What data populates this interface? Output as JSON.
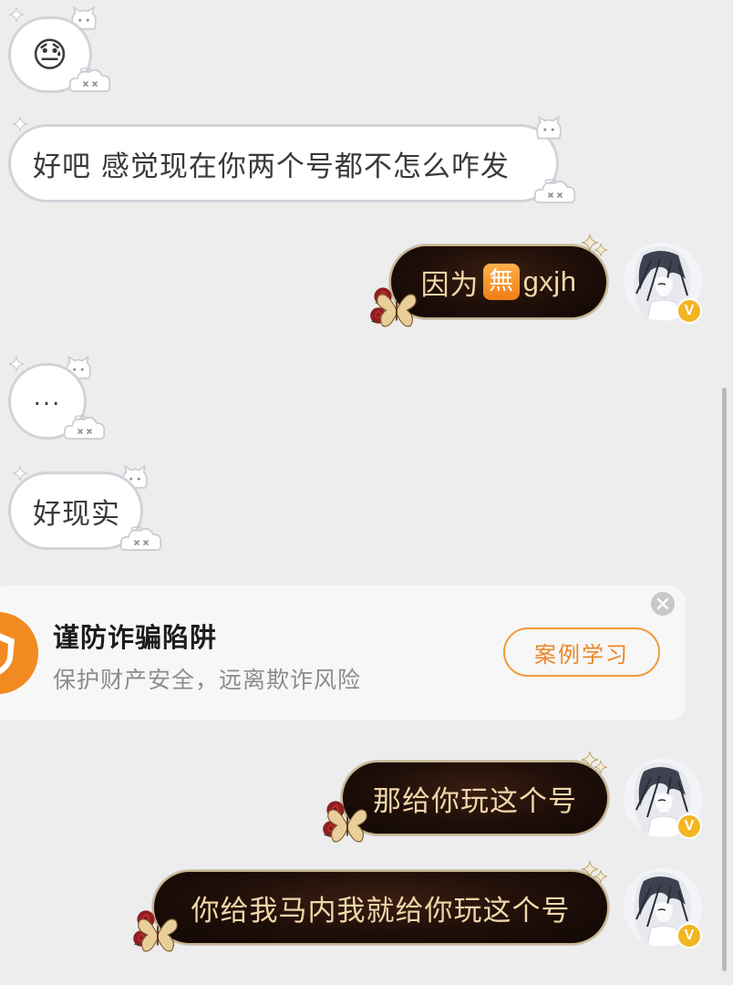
{
  "messages": [
    {
      "side": "left",
      "kind": "emoji",
      "emoji": "😓",
      "emoji_name": "sweat-emoji"
    },
    {
      "side": "left",
      "text": "好吧 感觉现在你两个号都不怎么咋发"
    },
    {
      "side": "right",
      "text_before": "因为",
      "badge": "無",
      "text_after": "gxjh"
    },
    {
      "side": "left",
      "text": "..."
    },
    {
      "side": "left",
      "text": "好现实"
    },
    {
      "side": "right",
      "text": "那给你玩这个号"
    },
    {
      "side": "right",
      "text": "你给我马内我就给你玩这个号"
    }
  ],
  "fraud_warning": {
    "title": "谨防诈骗陷阱",
    "subtitle": "保护财产安全，远离欺诈风险",
    "button_label": "案例学习"
  },
  "avatar_badge": "V",
  "colors": {
    "background": "#ededed",
    "incoming_bubble": "#ffffff",
    "outgoing_bubble": "#1d0e08",
    "outgoing_text": "#f1d6a9",
    "accent_orange": "#ee8425",
    "badge_gold": "#f2b623"
  },
  "icons": [
    "sparkle-icon",
    "cloud-deco-icon",
    "rose-icon",
    "butterfly-icon",
    "shield-icon",
    "close-icon",
    "verified-badge-icon"
  ]
}
